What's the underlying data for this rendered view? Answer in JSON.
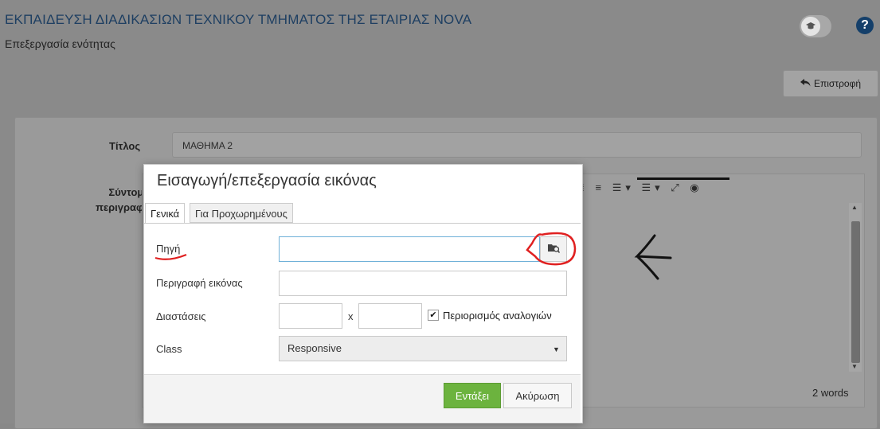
{
  "header": {
    "title": "ΕΚΠΑΙΔΕΥΣΗ ΔΙΑΔΙΚΑΣΙΩΝ ΤΕΧΝΙΚΟΥ ΤΜΗΜΑΤΟΣ ΤΗΣ ΕΤΑΙΡΙΑΣ NOVA",
    "subtitle": "Επεξεργασία ενότητας",
    "help_glyph": "?",
    "back_label": "Επιστροφή"
  },
  "form": {
    "title_label": "Τίτλος",
    "title_value": "ΜΑΘΗΜΑ 2",
    "short_desc_label_1": "Σύντομη",
    "short_desc_label_2": "περιγραφή"
  },
  "editor": {
    "toolbar_glyphs": "≣ ≡ ☰▾ ☰▾ ⤢ ◉",
    "word_count": "2 words"
  },
  "dialog": {
    "title": "Εισαγωγή/επεξεργασία εικόνας",
    "tabs": [
      {
        "label": "Γενικά",
        "active": true
      },
      {
        "label": "Για Προχωρημένους",
        "active": false
      }
    ],
    "source_label": "Πηγή",
    "source_value": "",
    "description_label": "Περιγραφή εικόνας",
    "description_value": "",
    "dimensions_label": "Διαστάσεις",
    "width_value": "",
    "height_value": "",
    "dim_separator": "x",
    "constrain_label": "Περιορισμός αναλογιών",
    "constrain_checked": true,
    "class_label": "Class",
    "class_value": "Responsive",
    "ok_label": "Εντάξει",
    "cancel_label": "Ακύρωση"
  },
  "colors": {
    "accent_title": "#1e3f62",
    "ok_button": "#6cb33e",
    "annotation": "#e02020"
  },
  "icons": [
    "graduation-cap-icon",
    "help-icon",
    "reply-arrow-icon",
    "browse-image-icon",
    "checkmark-icon",
    "caret-down-icon"
  ]
}
